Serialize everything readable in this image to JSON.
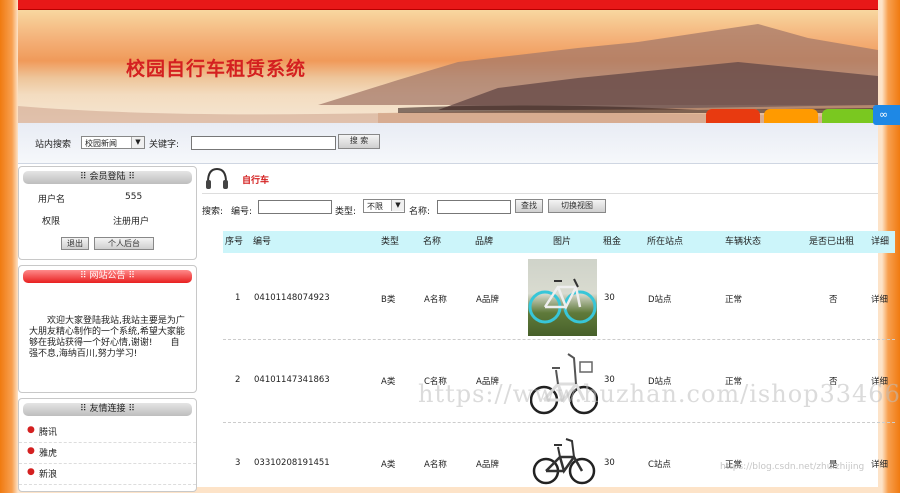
{
  "app": {
    "title": "校园自行车租赁系统"
  },
  "search": {
    "label": "站内搜索",
    "category": "校园新闻",
    "keyword_label": "关键字:",
    "keyword_value": "",
    "button": "搜 索"
  },
  "member": {
    "title": "会员登陆",
    "username_label": "用户名",
    "username_value": "555",
    "role_label": "权限",
    "role_value": "注册用户",
    "logout": "退出",
    "backend": "个人后台"
  },
  "notice": {
    "title": "网站公告",
    "text": "欢迎大家登陆我站,我站主要是为广大朋友精心制作的一个系统,希望大家能够在我站获得一个好心情,谢谢!　　自强不息,海纳百川,努力学习!"
  },
  "links": {
    "title": "友情连接",
    "items": [
      "腾讯",
      "雅虎",
      "新浪"
    ]
  },
  "section": {
    "title": "自行车"
  },
  "filter": {
    "search_label": "搜索:",
    "number_label": "编号:",
    "type_label": "类型:",
    "type_value": "不限",
    "name_label": "名称:",
    "find_button": "查找",
    "switch_button": "切换视图"
  },
  "table": {
    "headers": [
      "序号",
      "编号",
      "类型",
      "名称",
      "品牌",
      "图片",
      "租金",
      "所在站点",
      "车辆状态",
      "是否已出租",
      "详细"
    ],
    "rows": [
      {
        "index": "1",
        "number": "04101148074923",
        "type": "B类",
        "name": "A名称",
        "brand": "A品牌",
        "rent": "30",
        "site": "D站点",
        "status": "正常",
        "rented": "否",
        "detail": "详细"
      },
      {
        "index": "2",
        "number": "04101147341863",
        "type": "A类",
        "name": "C名称",
        "brand": "A品牌",
        "rent": "30",
        "site": "D站点",
        "status": "正常",
        "rented": "否",
        "detail": "详细"
      },
      {
        "index": "3",
        "number": "03310208191451",
        "type": "A类",
        "name": "A名称",
        "brand": "A品牌",
        "rent": "30",
        "site": "C站点",
        "status": "正常",
        "rented": "是",
        "detail": "详细"
      }
    ]
  },
  "watermark": {
    "main": "https://www.huzhan.com/ishop33466",
    "blog": "https://blog.csdn.net/zhuizhijing"
  },
  "colors": {
    "accent": "#d42020",
    "nav": "#e81818",
    "table_header": "#ccf5fa",
    "tab_red": "#e83a10",
    "tab_orange": "#ff9a00",
    "tab_green": "#7ac820"
  }
}
